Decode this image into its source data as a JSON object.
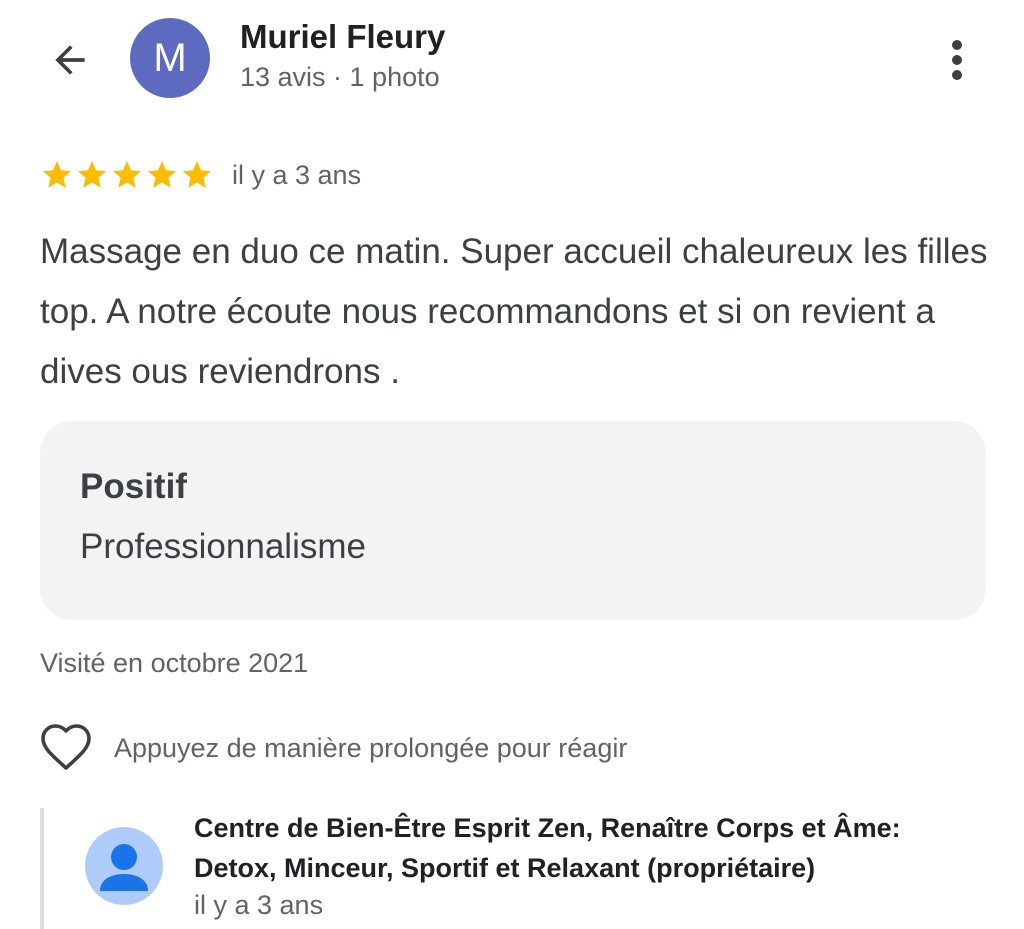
{
  "header": {
    "back_icon": "arrow-back-icon",
    "avatar_letter": "M",
    "avatar_color": "#5c6bc0",
    "author_name": "Muriel Fleury",
    "author_meta": "13 avis · 1 photo",
    "more_icon": "more-vertical-icon"
  },
  "review": {
    "rating": 5,
    "rating_max": 5,
    "star_color": "#fbbc04",
    "time": "il y a 3 ans",
    "text": "Massage en duo ce matin. Super accueil chaleureux les filles top. A notre écoute nous recommandons et si on revient a dives ous reviendrons ."
  },
  "positive": {
    "title": "Positif",
    "value": "Professionnalisme"
  },
  "visited": "Visité en octobre 2021",
  "react": {
    "icon": "heart-outline-icon",
    "label": "Appuyez de manière prolongée pour réagir"
  },
  "owner_reply": {
    "avatar_icon": "person-icon",
    "name": "Centre de Bien-Être Esprit Zen, Renaître Corps et Âme: Detox, Minceur, Sportif et Relaxant (propriétaire)",
    "time": "il y a 3 ans"
  }
}
